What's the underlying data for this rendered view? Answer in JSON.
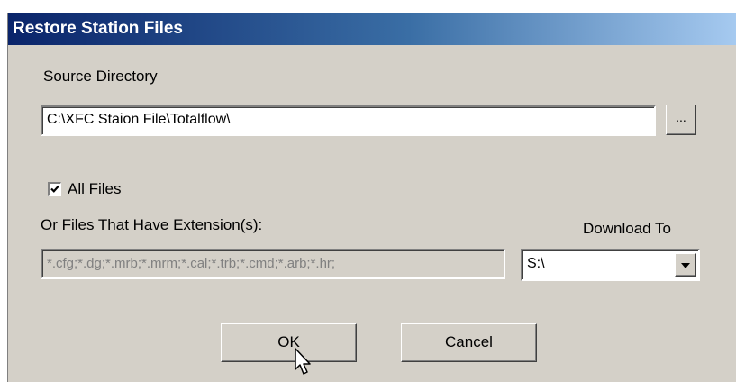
{
  "window": {
    "title": "Restore Station Files"
  },
  "source": {
    "label": "Source Directory",
    "path": "C:\\XFC Staion File\\Totalflow\\",
    "browse_label": "..."
  },
  "all_files": {
    "label": "All Files",
    "checked": true
  },
  "extensions": {
    "label": "Or Files That Have Extension(s):",
    "value": "*.cfg;*.dg;*.mrb;*.mrm;*.cal;*.trb;*.cmd;*.arb;*.hr;"
  },
  "download": {
    "label": "Download To",
    "selected": "S:\\"
  },
  "buttons": {
    "ok": "OK",
    "cancel": "Cancel"
  },
  "colors": {
    "titlebar_start": "#0a246a",
    "titlebar_end": "#a6caf0",
    "dialog_face": "#d4d0c8",
    "disabled_text": "#808080"
  }
}
